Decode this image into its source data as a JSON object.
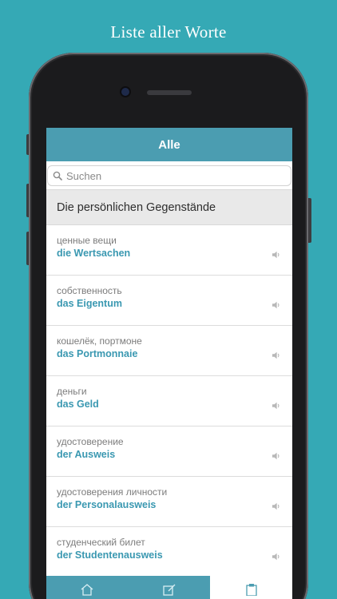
{
  "promo": {
    "title": "Liste aller Worte"
  },
  "nav": {
    "title": "Alle"
  },
  "search": {
    "placeholder": "Suchen"
  },
  "section": {
    "title": "Die persönlichen Gegenstände"
  },
  "items": [
    {
      "ru": "ценные вещи",
      "de": "die Wertsachen"
    },
    {
      "ru": "собственность",
      "de": "das Eigentum"
    },
    {
      "ru": "кошелёк, портмоне",
      "de": "das Portmonnaie"
    },
    {
      "ru": "деньги",
      "de": "das Geld"
    },
    {
      "ru": "удостоверение",
      "de": "der Ausweis"
    },
    {
      "ru": "удостоверения личности",
      "de": "der Personalausweis"
    },
    {
      "ru": "студенческий билет",
      "de": "der Studentenausweis"
    }
  ],
  "icons": {
    "search": "search-icon",
    "speaker": "speaker-icon",
    "tab_home": "home-icon",
    "tab_edit": "edit-icon",
    "tab_list": "clipboard-icon"
  },
  "colors": {
    "background": "#35a9b5",
    "accent": "#4b9db1",
    "word_text": "#3a98b1",
    "section_bg": "#e9e9e9"
  }
}
